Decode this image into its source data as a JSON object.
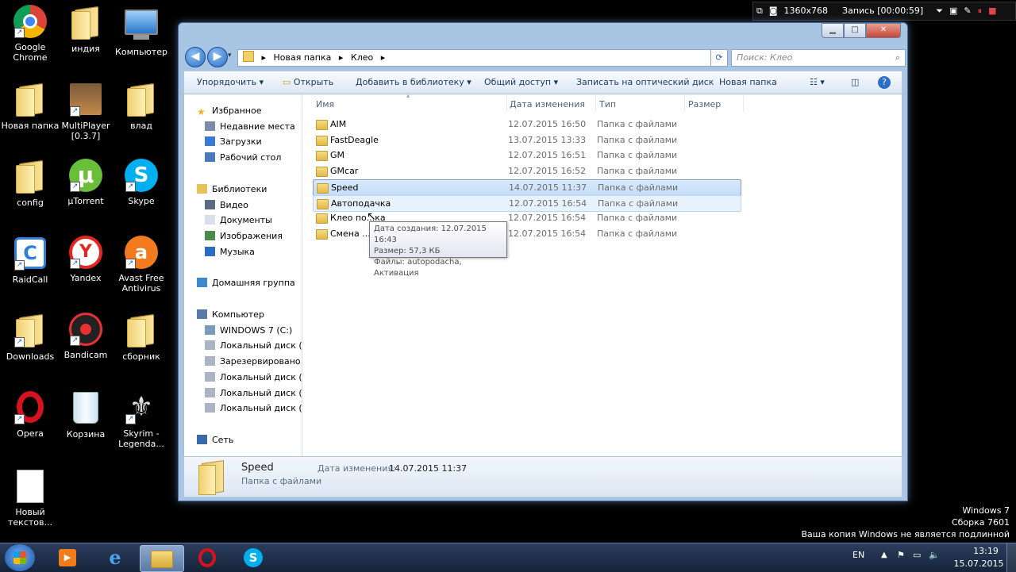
{
  "recorder": {
    "resolution": "1360x768",
    "recording": "Запись [00:00:59]"
  },
  "desktop_icons": [
    {
      "label": "Google Chrome",
      "icon": "chrome-icon",
      "col": 0,
      "row": 0
    },
    {
      "label": "индия",
      "icon": "folder-icon",
      "col": 1,
      "row": 0
    },
    {
      "label": "Компьютер",
      "icon": "computer-icon",
      "col": 2,
      "row": 0
    },
    {
      "label": "Новая папка",
      "icon": "folder-icon",
      "col": 0,
      "row": 1
    },
    {
      "label": "MultiPlayer [0.3.7]",
      "icon": "game-icon",
      "col": 1,
      "row": 1
    },
    {
      "label": "влад",
      "icon": "folder-icon",
      "col": 2,
      "row": 1
    },
    {
      "label": "config",
      "icon": "folder-icon",
      "col": 0,
      "row": 2
    },
    {
      "label": "µTorrent",
      "icon": "utorrent-icon",
      "col": 1,
      "row": 2
    },
    {
      "label": "Skype",
      "icon": "skype-icon",
      "col": 2,
      "row": 2
    },
    {
      "label": "RaidCall",
      "icon": "raidcall-icon",
      "col": 0,
      "row": 3
    },
    {
      "label": "Yandex",
      "icon": "yandex-icon",
      "col": 1,
      "row": 3
    },
    {
      "label": "Avast Free Antivirus",
      "icon": "avast-icon",
      "col": 2,
      "row": 3
    },
    {
      "label": "Downloads",
      "icon": "downloads-folder-icon",
      "col": 0,
      "row": 4
    },
    {
      "label": "Bandicam",
      "icon": "bandicam-icon",
      "col": 1,
      "row": 4
    },
    {
      "label": "сборник",
      "icon": "folder-icon",
      "col": 2,
      "row": 4
    },
    {
      "label": "Opera",
      "icon": "opera-icon",
      "col": 0,
      "row": 5
    },
    {
      "label": "Корзина",
      "icon": "recycle-bin-icon",
      "col": 1,
      "row": 5
    },
    {
      "label": "Skyrim - Legenda...",
      "icon": "skyrim-icon",
      "col": 2,
      "row": 5
    },
    {
      "label": "Новый текстов...",
      "icon": "text-file-icon",
      "col": 0,
      "row": 6
    }
  ],
  "explorer": {
    "breadcrumb": [
      "Новая папка",
      "Клео"
    ],
    "search_placeholder": "Поиск: Клео",
    "toolbar": {
      "organize": "Упорядочить",
      "open": "Открыть",
      "add_to_library": "Добавить в библиотеку",
      "share": "Общий доступ",
      "burn": "Записать на оптический диск",
      "new_folder": "Новая папка"
    },
    "nav": [
      {
        "label": "Избранное",
        "icon": "star-icon",
        "indent": 0
      },
      {
        "label": "Недавние места",
        "icon": "recent-places-icon",
        "indent": 1
      },
      {
        "label": "Загрузки",
        "icon": "downloads-icon",
        "indent": 1
      },
      {
        "label": "Рабочий стол",
        "icon": "desktop-icon",
        "indent": 1
      },
      {
        "label": "",
        "icon": "",
        "indent": 0
      },
      {
        "label": "Библиотеки",
        "icon": "libraries-icon",
        "indent": 0
      },
      {
        "label": "Видео",
        "icon": "video-icon",
        "indent": 1
      },
      {
        "label": "Документы",
        "icon": "documents-icon",
        "indent": 1
      },
      {
        "label": "Изображения",
        "icon": "pictures-icon",
        "indent": 1
      },
      {
        "label": "Музыка",
        "icon": "music-icon",
        "indent": 1
      },
      {
        "label": "",
        "icon": "",
        "indent": 0
      },
      {
        "label": "Домашняя группа",
        "icon": "homegroup-icon",
        "indent": 0
      },
      {
        "label": "",
        "icon": "",
        "indent": 0
      },
      {
        "label": "Компьютер",
        "icon": "computer-icon",
        "indent": 0
      },
      {
        "label": "WINDOWS 7 (C:)",
        "icon": "system-drive-icon",
        "indent": 1
      },
      {
        "label": "Локальный диск (D",
        "icon": "drive-icon",
        "indent": 1
      },
      {
        "label": "Зарезервировано с",
        "icon": "drive-icon",
        "indent": 1
      },
      {
        "label": "Локальный диск (G",
        "icon": "drive-icon",
        "indent": 1
      },
      {
        "label": "Локальный диск (H",
        "icon": "drive-icon",
        "indent": 1
      },
      {
        "label": "Локальный диск (I:)",
        "icon": "drive-icon",
        "indent": 1
      },
      {
        "label": "",
        "icon": "",
        "indent": 0
      },
      {
        "label": "Сеть",
        "icon": "network-icon",
        "indent": 0
      }
    ],
    "columns": [
      "Имя",
      "Дата изменения",
      "Тип",
      "Размер"
    ],
    "files": [
      {
        "name": "AIM",
        "date": "12.07.2015 16:50",
        "type": "Папка с файлами",
        "state": ""
      },
      {
        "name": "FastDeagle",
        "date": "13.07.2015 13:33",
        "type": "Папка с файлами",
        "state": ""
      },
      {
        "name": "GM",
        "date": "12.07.2015 16:51",
        "type": "Папка с файлами",
        "state": ""
      },
      {
        "name": "GMcar",
        "date": "12.07.2015 16:52",
        "type": "Папка с файлами",
        "state": ""
      },
      {
        "name": "Speed",
        "date": "14.07.2015 11:37",
        "type": "Папка с файлами",
        "state": "selected"
      },
      {
        "name": "Автоподачка",
        "date": "12.07.2015 16:54",
        "type": "Папка с файлами",
        "state": "hover"
      },
      {
        "name": "Клео по...ка",
        "date": "12.07.2015 16:54",
        "type": "Папка с файлами",
        "state": ""
      },
      {
        "name": "Смена ...",
        "date": "12.07.2015 16:54",
        "type": "Папка с файлами",
        "state": ""
      }
    ],
    "tooltip": [
      "Дата создания: 12.07.2015 16:43",
      "Размер: 57,3 КБ",
      "Файлы: autopodacha, Активация"
    ],
    "details": {
      "name": "Speed",
      "type": "Папка с файлами",
      "modified_label": "Дата изменения:",
      "modified_value": "14.07.2015 11:37"
    }
  },
  "watermark": [
    "Windows 7",
    "Сборка 7601",
    "Ваша копия Windows не является подлинной"
  ],
  "tray": {
    "lang": "EN",
    "time": "13:19",
    "date": "15.07.2015"
  }
}
